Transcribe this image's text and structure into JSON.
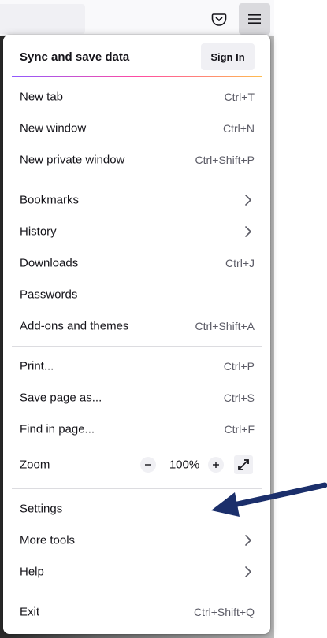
{
  "menu": {
    "sync": {
      "label": "Sync and save data",
      "button": "Sign In"
    },
    "items": [
      {
        "label": "New tab",
        "shortcut": "Ctrl+T"
      },
      {
        "label": "New window",
        "shortcut": "Ctrl+N"
      },
      {
        "label": "New private window",
        "shortcut": "Ctrl+Shift+P"
      },
      {
        "label": "Bookmarks",
        "submenu": true
      },
      {
        "label": "History",
        "submenu": true
      },
      {
        "label": "Downloads",
        "shortcut": "Ctrl+J"
      },
      {
        "label": "Passwords"
      },
      {
        "label": "Add-ons and themes",
        "shortcut": "Ctrl+Shift+A"
      },
      {
        "label": "Print...",
        "shortcut": "Ctrl+P"
      },
      {
        "label": "Save page as...",
        "shortcut": "Ctrl+S"
      },
      {
        "label": "Find in page...",
        "shortcut": "Ctrl+F"
      },
      {
        "label": "Zoom"
      },
      {
        "label": "Settings"
      },
      {
        "label": "More tools",
        "submenu": true
      },
      {
        "label": "Help",
        "submenu": true
      },
      {
        "label": "Exit",
        "shortcut": "Ctrl+Shift+Q"
      }
    ],
    "zoom": {
      "minus": "−",
      "value": "100%",
      "plus": "+"
    }
  },
  "toolbar": {
    "icons": [
      "pocket-icon",
      "hamburger-menu-icon"
    ]
  },
  "annotation": {
    "arrow_color": "#1b2f6b",
    "points_to": "Settings"
  }
}
